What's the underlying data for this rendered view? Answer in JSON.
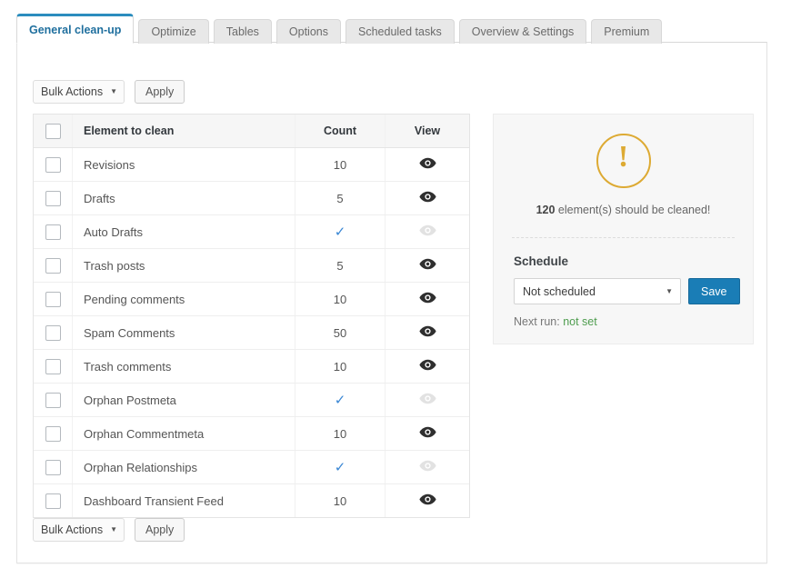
{
  "tabs": [
    {
      "label": "General clean-up",
      "active": true
    },
    {
      "label": "Optimize",
      "active": false
    },
    {
      "label": "Tables",
      "active": false
    },
    {
      "label": "Options",
      "active": false
    },
    {
      "label": "Scheduled tasks",
      "active": false
    },
    {
      "label": "Overview & Settings",
      "active": false
    },
    {
      "label": "Premium",
      "active": false
    }
  ],
  "bulk_actions": {
    "select_value": "Bulk Actions",
    "apply_label": "Apply",
    "caret_icon": "chevron-down-icon"
  },
  "table": {
    "columns": {
      "select_all": "",
      "element": "Element to clean",
      "count": "Count",
      "view": "View"
    },
    "rows": [
      {
        "name": "Revisions",
        "count": "10",
        "count_is_check": false,
        "view_enabled": true
      },
      {
        "name": "Drafts",
        "count": "5",
        "count_is_check": false,
        "view_enabled": true
      },
      {
        "name": "Auto Drafts",
        "count": "",
        "count_is_check": true,
        "view_enabled": false
      },
      {
        "name": "Trash posts",
        "count": "5",
        "count_is_check": false,
        "view_enabled": true
      },
      {
        "name": "Pending comments",
        "count": "10",
        "count_is_check": false,
        "view_enabled": true
      },
      {
        "name": "Spam Comments",
        "count": "50",
        "count_is_check": false,
        "view_enabled": true
      },
      {
        "name": "Trash comments",
        "count": "10",
        "count_is_check": false,
        "view_enabled": true
      },
      {
        "name": "Orphan Postmeta",
        "count": "",
        "count_is_check": true,
        "view_enabled": false
      },
      {
        "name": "Orphan Commentmeta",
        "count": "10",
        "count_is_check": false,
        "view_enabled": true
      },
      {
        "name": "Orphan Relationships",
        "count": "",
        "count_is_check": true,
        "view_enabled": false
      },
      {
        "name": "Dashboard Transient Feed",
        "count": "10",
        "count_is_check": false,
        "view_enabled": true
      }
    ]
  },
  "info_panel": {
    "warning_icon": "exclamation-circle-icon",
    "count": "120",
    "message": " element(s) should be cleaned!",
    "schedule_title": "Schedule",
    "schedule_value": "Not scheduled",
    "save_label": "Save",
    "next_run_label": "Next run: ",
    "next_run_value": "not set"
  },
  "colors": {
    "accent_blue": "#1a7db6",
    "tab_active_text": "#1f6f9e",
    "check_blue": "#3a87d4",
    "warning_gold": "#ddaa33",
    "success_green": "#4f9d4f"
  }
}
